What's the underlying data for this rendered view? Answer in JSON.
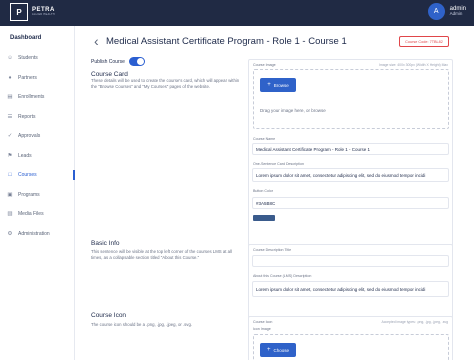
{
  "topbar": {
    "logo_mark": "P",
    "logo_name": "PETRA",
    "logo_sub": "ALLIED HEALTH",
    "avatar_letter": "A",
    "user_name": "admin",
    "user_role": "Admin"
  },
  "sidebar": {
    "title": "Dashboard",
    "items": [
      {
        "label": "Students",
        "icon": "students-icon",
        "glyph": "☺"
      },
      {
        "label": "Partners",
        "icon": "partners-icon",
        "glyph": "♦"
      },
      {
        "label": "Enrollments",
        "icon": "enrollments-icon",
        "glyph": "▤"
      },
      {
        "label": "Reports",
        "icon": "reports-icon",
        "glyph": "☰"
      },
      {
        "label": "Approvals",
        "icon": "approvals-icon",
        "glyph": "✓"
      },
      {
        "label": "Leads",
        "icon": "leads-icon",
        "glyph": "⚑"
      },
      {
        "label": "Courses",
        "icon": "courses-icon",
        "glyph": "□"
      },
      {
        "label": "Programs",
        "icon": "programs-icon",
        "glyph": "▣"
      },
      {
        "label": "Media Files",
        "icon": "media-icon",
        "glyph": "▧"
      },
      {
        "label": "Administration",
        "icon": "admin-icon",
        "glyph": "⚙"
      }
    ],
    "active_index": 6
  },
  "header": {
    "title": "Medical Assistant Certificate Program - Role 1 - Course 1",
    "course_code": "Course Code: 7TBL82"
  },
  "publish": {
    "label": "Publish Course",
    "enabled": true
  },
  "course_card": {
    "title": "Course Card",
    "description": "These details will be used to create the course's card, which will appear within the \"Browse Courses\" and \"My Courses\" pages of the website.",
    "image_label": "Course Image",
    "image_hint": "Image size: 400x 300px (Width X Height) Max",
    "browse_label": "Browse",
    "drag_text": "Drag your image here, or browse",
    "name_label": "Course Name",
    "name_value": "Medical Assistant Certificate Program - Role 1 - Course 1",
    "short_desc_label": "One-Sentence Card Description",
    "short_desc_value": "Lorem ipsum dolor sit amet, consectetur adipiscing elit, sed do eiusmod tempor incidi",
    "color_label": "Button Color",
    "color_value": "#3A5B8C",
    "swatch_color": "#3a5b8c"
  },
  "basic_info": {
    "title": "Basic Info",
    "description": "This sentence will be visible at the top left corner of the courses LMS at all times, as a collapsable section titled \"About this Course.\"",
    "desc_title_label": "Course Description Title",
    "about_label": "About this Course (LMS) Description",
    "about_value": "Lorem ipsum dolor sit amet, consectetur adipiscing elit, sed do eiusmod tempor incidi"
  },
  "course_icon": {
    "title": "Course Icon",
    "description": "The course icon should be a .png, .jpg, .jpeg, or .svg.",
    "icon_label": "Course Icon",
    "icon_hint": "Accepted image types: .png, .jpg, .jpeg, .svg",
    "icon_image_label": "Icon Image",
    "choose_label": "Choose"
  }
}
